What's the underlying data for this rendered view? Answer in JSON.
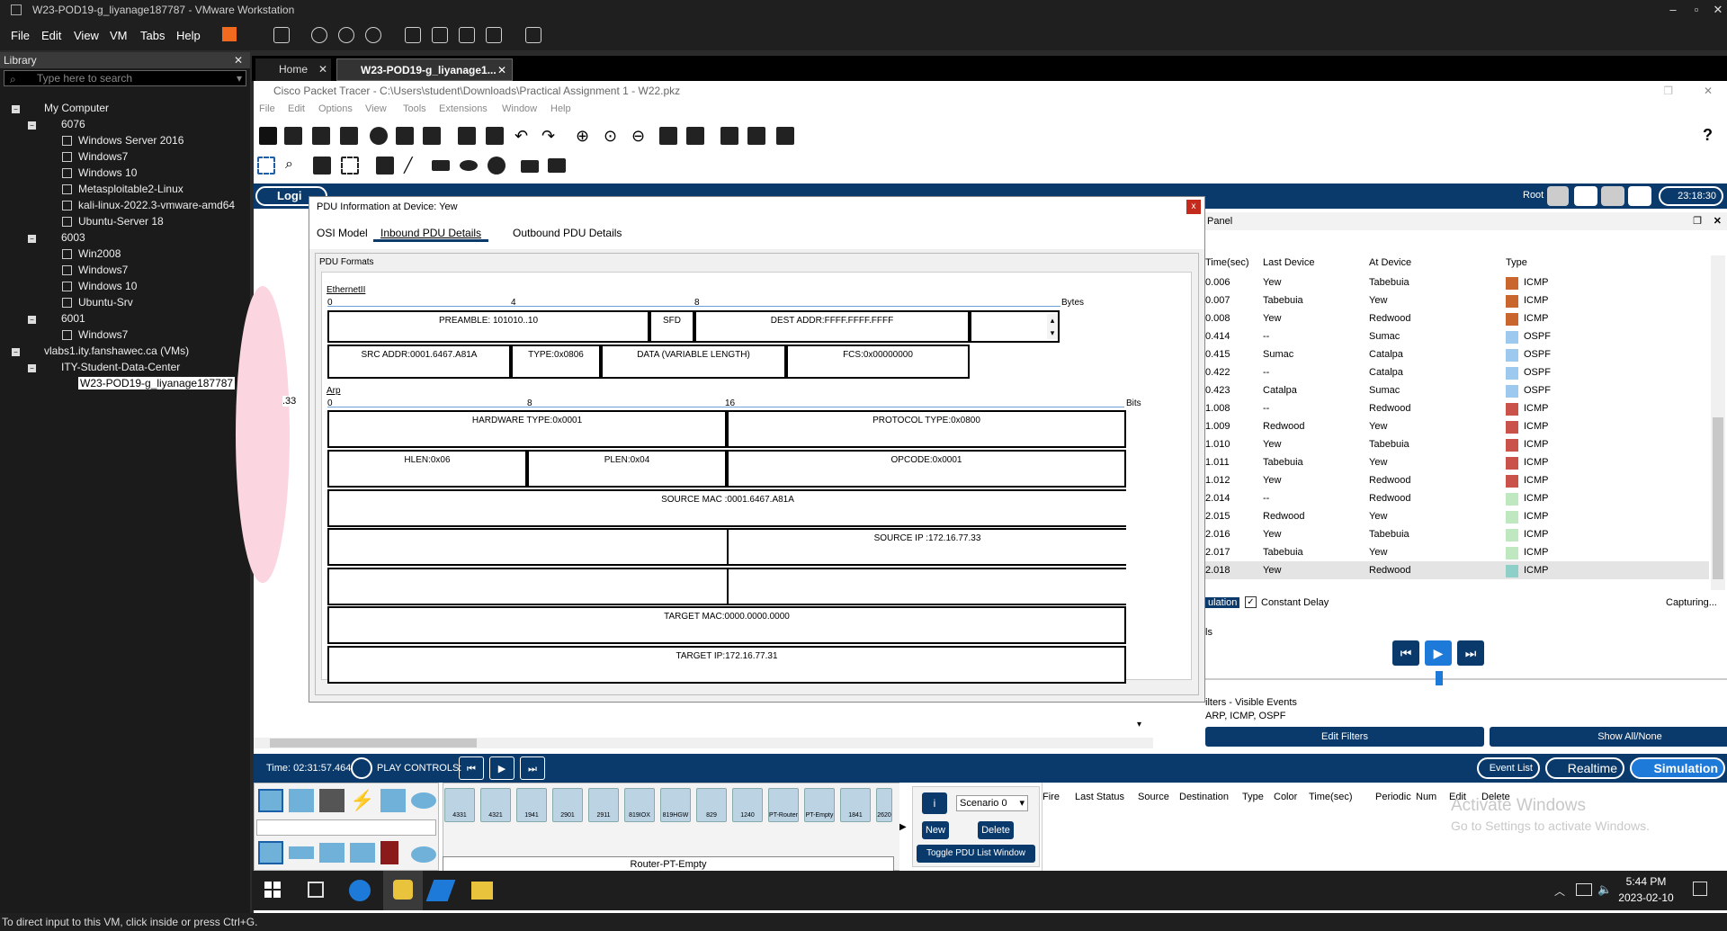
{
  "vm": {
    "title": "W23-POD19-g_liyanage187787 - VMware Workstation",
    "menu": [
      "File",
      "Edit",
      "View",
      "VM",
      "Tabs",
      "Help"
    ],
    "status": "To direct input to this VM, click inside or press Ctrl+G."
  },
  "library": {
    "title": "Library",
    "search_placeholder": "Type here to search",
    "items": [
      "My Computer",
      "6076",
      "Windows Server 2016",
      "Windows7",
      "Windows 10",
      "Metasploitable2-Linux",
      "kali-linux-2022.3-vmware-amd64",
      "Ubuntu-Server 18",
      "6003",
      "Win2008",
      "Windows7",
      "Windows 10",
      "Ubuntu-Srv",
      "6001",
      "Windows7",
      "vlabs1.ity.fanshawec.ca (VMs)",
      "ITY-Student-Data-Center",
      "W23-POD19-g_liyanage187787"
    ]
  },
  "tabs": {
    "home": "Home",
    "vm": "W23-POD19-g_liyanage1..."
  },
  "pt": {
    "title": "Cisco Packet Tracer - C:\\Users\\student\\Downloads\\Practical Assignment 1 - W22.pkz",
    "menu": [
      "File",
      "Edit",
      "Options",
      "View",
      "Tools",
      "Extensions",
      "Window",
      "Help"
    ],
    "logical": "Logi",
    "root": "Root",
    "clock": "23:18:30",
    "time": "Time: 02:31:57.464",
    "play_controls": "PLAY CONTROLS:",
    "label_33": ".33"
  },
  "dialog": {
    "title": "PDU Information at Device: Yew",
    "close": "x",
    "tabs": [
      "OSI Model",
      "Inbound PDU Details",
      "Outbound PDU Details"
    ],
    "group": "PDU Formats",
    "eth": {
      "label": "EthernetII",
      "r0": "0",
      "r4": "4",
      "r8": "8",
      "unit": "Bytes",
      "preamble": "PREAMBLE: 101010..10",
      "sfd": "SFD",
      "dest": "DEST ADDR:FFFF.FFFF.FFFF",
      "src": "SRC ADDR:0001.6467.A81A",
      "type": "TYPE:0x0806",
      "data": "DATA (VARIABLE LENGTH)",
      "fcs": "FCS:0x00000000"
    },
    "arp": {
      "label": "Arp",
      "r0": "0",
      "r8": "8",
      "r16": "16",
      "unit": "Bits",
      "hw": "HARDWARE TYPE:0x0001",
      "proto": "PROTOCOL TYPE:0x0800",
      "hlen": "HLEN:0x06",
      "plen": "PLEN:0x04",
      "opcode": "OPCODE:0x0001",
      "smac": "SOURCE MAC :0001.6467.A81A",
      "sip": "SOURCE IP :172.16.77.33",
      "tmac": "TARGET MAC:0000.0000.0000",
      "tip": "TARGET IP:172.16.77.31"
    }
  },
  "events": {
    "panel": "Panel",
    "headers": [
      "Time(sec)",
      "Last Device",
      "At Device",
      "Type"
    ],
    "rows": [
      [
        "0.006",
        "Yew",
        "Tabebuia",
        "ICMP",
        "#c8662e"
      ],
      [
        "0.007",
        "Tabebuia",
        "Yew",
        "ICMP",
        "#c8662e"
      ],
      [
        "0.008",
        "Yew",
        "Redwood",
        "ICMP",
        "#c8662e"
      ],
      [
        "0.414",
        "--",
        "Sumac",
        "OSPF",
        "#9ec9ef"
      ],
      [
        "0.415",
        "Sumac",
        "Catalpa",
        "OSPF",
        "#9ec9ef"
      ],
      [
        "0.422",
        "--",
        "Catalpa",
        "OSPF",
        "#9ec9ef"
      ],
      [
        "0.423",
        "Catalpa",
        "Sumac",
        "OSPF",
        "#9ec9ef"
      ],
      [
        "1.008",
        "--",
        "Redwood",
        "ICMP",
        "#c9524a"
      ],
      [
        "1.009",
        "Redwood",
        "Yew",
        "ICMP",
        "#c9524a"
      ],
      [
        "1.010",
        "Yew",
        "Tabebuia",
        "ICMP",
        "#c9524a"
      ],
      [
        "1.011",
        "Tabebuia",
        "Yew",
        "ICMP",
        "#c9524a"
      ],
      [
        "1.012",
        "Yew",
        "Redwood",
        "ICMP",
        "#c9524a"
      ],
      [
        "2.014",
        "--",
        "Redwood",
        "ICMP",
        "#bfe8c0"
      ],
      [
        "2.015",
        "Redwood",
        "Yew",
        "ICMP",
        "#bfe8c0"
      ],
      [
        "2.016",
        "Yew",
        "Tabebuia",
        "ICMP",
        "#bfe8c0"
      ],
      [
        "2.017",
        "Tabebuia",
        "Yew",
        "ICMP",
        "#bfe8c0"
      ],
      [
        "2.018",
        "Yew",
        "Redwood",
        "ICMP",
        "#8ed0c8"
      ]
    ],
    "sim_label": "ulation",
    "constant_delay": "Constant Delay",
    "capturing": "Capturing...",
    "ls": "ls",
    "filters": "ilters - Visible Events",
    "filter_list": "ARP, ICMP, OSPF",
    "edit_filters": "Edit Filters",
    "show_all": "Show All/None",
    "event_list": "Event List",
    "realtime": "Realtime",
    "simulation": "Simulation"
  },
  "bottom": {
    "devices": [
      "4331",
      "4321",
      "1941",
      "2901",
      "2911",
      "819IOX",
      "819HGW",
      "829",
      "1240",
      "PT-Router",
      "PT-Empty",
      "1841",
      "2620"
    ],
    "selected": "Router-PT-Empty",
    "scenario": "Scenario 0",
    "new": "New",
    "delete": "Delete",
    "toggle": "Toggle PDU List Window",
    "pdu_headers": [
      "Fire",
      "Last Status",
      "Source",
      "Destination",
      "Type",
      "Color",
      "Time(sec)",
      "Periodic",
      "Num",
      "Edit",
      "Delete"
    ],
    "activate1": "Activate Windows",
    "activate2": "Go to Settings to activate Windows."
  },
  "taskbar": {
    "time": "5:44 PM",
    "date": "2023-02-10"
  }
}
